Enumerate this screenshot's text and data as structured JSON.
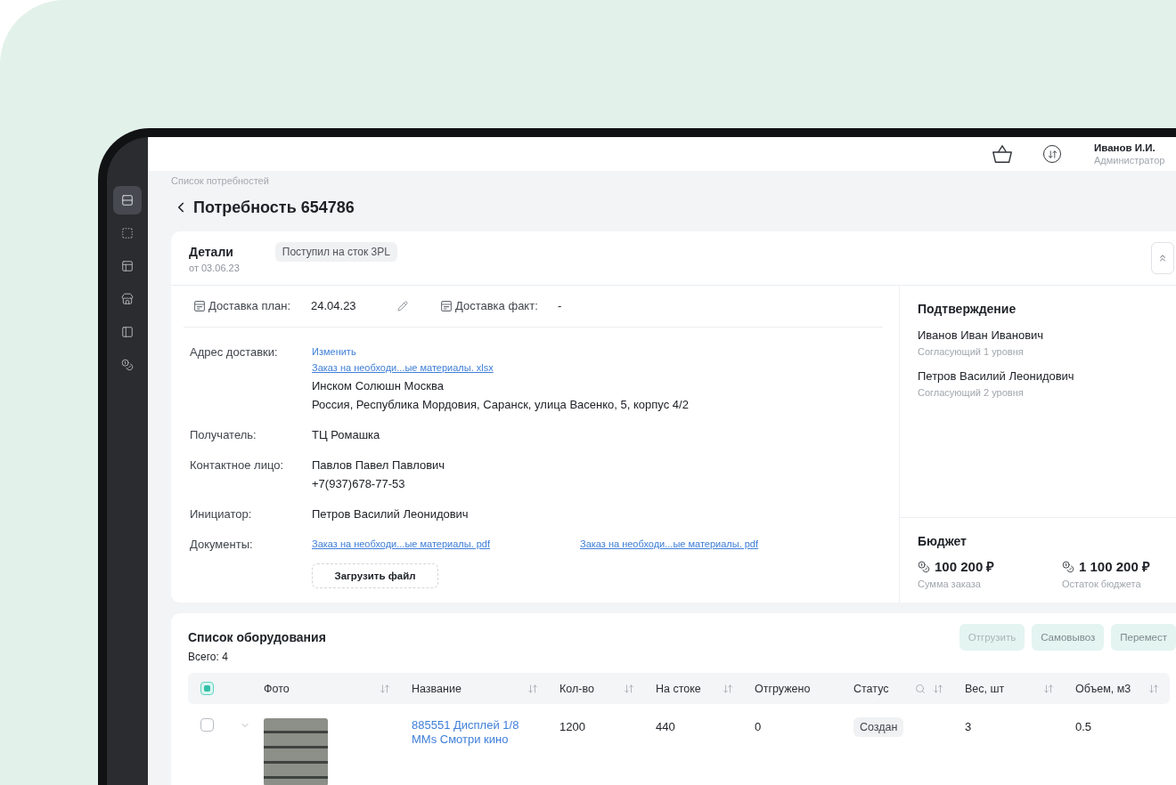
{
  "sidebar": {
    "items": [
      {
        "selected": true
      },
      {
        "selected": false
      },
      {
        "selected": false
      },
      {
        "selected": false
      },
      {
        "selected": false
      },
      {
        "selected": false
      }
    ]
  },
  "header": {
    "user_name": "Иванов И.И.",
    "user_role": "Администратор"
  },
  "breadcrumb": "Список потребностей",
  "title": "Потребность 654786",
  "details": {
    "title": "Детали",
    "date": "от 03.06.23",
    "status": "Поступил на сток 3PL",
    "delivery": [
      {
        "label": "Доставка план:",
        "value": "24.04.23",
        "editable": true
      },
      {
        "label": "Доставка факт:",
        "value": "-",
        "editable": false
      }
    ],
    "fields": [
      {
        "kind": "lines",
        "label": "Адрес доставки:",
        "lines": [
          {
            "kind": "action",
            "text": "Изменить"
          },
          {
            "kind": "file",
            "text": "Заказ на необходи...ые материалы. xlsx"
          },
          {
            "kind": "text",
            "text": "Инском Солюшн Москва"
          },
          {
            "kind": "text",
            "text": "Россия, Республика Мордовия, Саранск, улица Васенко, 5, корпус 4/2"
          }
        ]
      },
      {
        "kind": "lines",
        "label": "Получатель:",
        "lines": [
          {
            "kind": "text",
            "text": "ТЦ Ромашка"
          }
        ]
      },
      {
        "kind": "lines",
        "label": "Контактное лицо:",
        "lines": [
          {
            "kind": "text",
            "text": "Павлов Павел Павлович"
          },
          {
            "kind": "text",
            "text": "+7(937)678-77-53"
          }
        ]
      },
      {
        "kind": "lines",
        "label": "Инициатор:",
        "lines": [
          {
            "kind": "text",
            "text": "Петров Василий Леонидович"
          }
        ]
      },
      {
        "kind": "documents",
        "label": "Документы:",
        "files": [
          "Заказ на необходи...ые материалы. pdf",
          "Заказ на необходи...ые материалы. pdf"
        ],
        "upload_button": "Загрузить файл"
      }
    ]
  },
  "approval": {
    "title": "Подтверждение",
    "approvers": [
      {
        "name": "Иванов Иван Иванович",
        "role": "Согласующий 1 уровня"
      },
      {
        "name": "Петров Василий Леонидович",
        "role": "Согласующий 2 уровня"
      }
    ]
  },
  "budget": {
    "title": "Бюджет",
    "items": [
      {
        "amount": "100 200 ₽",
        "label": "Сумма заказа"
      },
      {
        "amount": "1 100 200 ₽",
        "label": "Остаток бюджета"
      }
    ]
  },
  "equipment": {
    "title": "Список оборудования",
    "actions": [
      {
        "label": "Отгрузить",
        "disabled": true
      },
      {
        "label": "Самовывоз",
        "disabled": false
      },
      {
        "label": "Перемест",
        "disabled": false
      }
    ],
    "total": "Всего: 4",
    "select_all": {
      "checked": true
    },
    "columns": [
      {
        "label": "Фото",
        "sortable": true,
        "searchable": false
      },
      {
        "label": "Название",
        "sortable": true,
        "searchable": false
      },
      {
        "label": "Кол-во",
        "sortable": true,
        "searchable": false
      },
      {
        "label": "На стоке",
        "sortable": true,
        "searchable": false
      },
      {
        "label": "Отгружено",
        "sortable": false,
        "searchable": false
      },
      {
        "label": "Статус",
        "sortable": true,
        "searchable": true
      },
      {
        "label": "Вес, шт",
        "sortable": true,
        "searchable": false
      },
      {
        "label": "Объем, м3",
        "sortable": true,
        "searchable": false
      }
    ],
    "rows": [
      {
        "checked": false,
        "expanded": false,
        "name": "885551 Дисплей 1/8 MMs Смотри кино",
        "quantity": "1200",
        "in_stock": "440",
        "shipped": "0",
        "status": "Создан",
        "weight": "3",
        "volume": "0.5"
      }
    ]
  }
}
